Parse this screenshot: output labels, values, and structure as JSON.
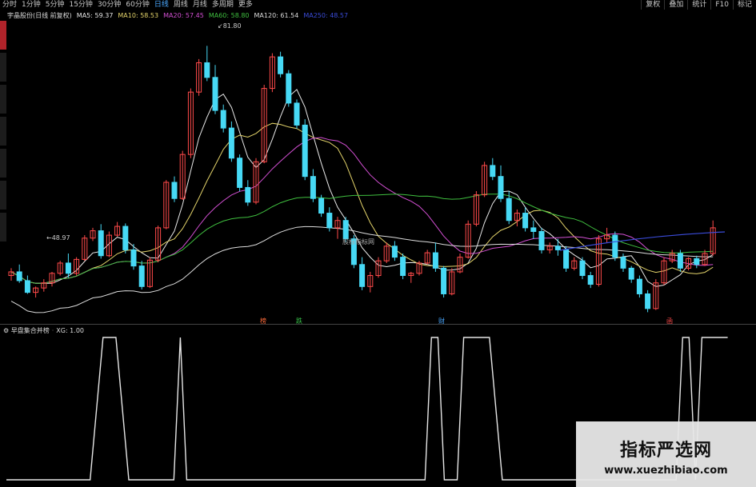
{
  "toolbar": {
    "periods": [
      "分时",
      "1分钟",
      "5分钟",
      "15分钟",
      "30分钟",
      "60分钟",
      "日线",
      "周线",
      "月线",
      "多周期",
      "更多"
    ],
    "active_period": "日线",
    "tools": [
      "复权",
      "叠加",
      "统计",
      "F10",
      "标记"
    ]
  },
  "legend": {
    "stock_title": "宇晶股份(日线 前复权)",
    "ma5": "MA5: 59.37",
    "ma10": "MA10: 58.53",
    "ma20": "MA20: 57.45",
    "ma60": "MA60: 58.80",
    "ma120": "MA120: 61.54",
    "ma250": "MA250: 48.57"
  },
  "colors": {
    "ma5": "#e8e8e8",
    "ma10": "#e3d36a",
    "ma20": "#d24fd2",
    "ma60": "#3fbf3f",
    "ma120": "#dcdcdc",
    "ma250": "#3a4bd8",
    "up": "#ff4a4a",
    "down": "#47d9f5",
    "active": "#4aa8ff"
  },
  "price_labels": {
    "high": "81.80",
    "low": "48.97"
  },
  "center_label": "股标指标网",
  "markers": [
    {
      "text": "榜",
      "color": "#ff6b3b"
    },
    {
      "text": "跌",
      "color": "#39c44a"
    },
    {
      "text": "财",
      "color": "#4aa8ff"
    },
    {
      "text": "函",
      "color": "#ff4a4a"
    }
  ],
  "indicator": {
    "name": "早盘集合并榜",
    "value": "XG: 1.00"
  },
  "watermark": {
    "title": "指标严选网",
    "url": "www.xuezhibiao.com"
  },
  "chart_data": {
    "type": "candlestick",
    "price_range": [
      45,
      85
    ],
    "candles": [
      [
        0,
        50.5,
        51.5,
        49.8,
        51
      ],
      [
        1,
        51,
        52,
        49.5,
        49.8
      ],
      [
        2,
        49.8,
        50.5,
        48,
        48.2
      ],
      [
        3,
        48.2,
        49,
        47.5,
        48.8
      ],
      [
        4,
        48.8,
        50,
        48.3,
        49.5
      ],
      [
        5,
        49.5,
        51,
        49,
        50.8
      ],
      [
        6,
        50.8,
        52.5,
        50.5,
        52.2
      ],
      [
        7,
        52.2,
        53.5,
        50.2,
        50.8
      ],
      [
        8,
        50.8,
        53,
        50.5,
        52.7
      ],
      [
        9,
        52.7,
        56,
        52.5,
        55.6
      ],
      [
        10,
        55.6,
        57,
        55.2,
        56.6
      ],
      [
        11,
        56.6,
        57.5,
        52.8,
        53.2
      ],
      [
        12,
        53.2,
        56.5,
        53,
        56
      ],
      [
        13,
        56,
        57.8,
        55.8,
        57.2
      ],
      [
        14,
        57.2,
        57.6,
        53.5,
        54
      ],
      [
        15,
        54,
        54.8,
        51.3,
        51.8
      ],
      [
        16,
        51.8,
        52.5,
        48.6,
        49
      ],
      [
        17,
        49,
        53,
        48.8,
        52.6
      ],
      [
        18,
        52.6,
        57.3,
        52.3,
        57
      ],
      [
        19,
        57,
        63.5,
        56.8,
        63.2
      ],
      [
        20,
        63.2,
        64,
        60.5,
        61
      ],
      [
        21,
        61,
        67.5,
        60.8,
        67
      ],
      [
        22,
        67,
        76,
        66.5,
        75.5
      ],
      [
        23,
        75.5,
        80,
        75,
        79.5
      ],
      [
        24,
        79.5,
        81.8,
        77,
        77.5
      ],
      [
        25,
        77.5,
        79.2,
        72.5,
        73
      ],
      [
        26,
        73,
        73.8,
        70,
        70.6
      ],
      [
        27,
        70.6,
        71.5,
        66,
        66.5
      ],
      [
        28,
        66.5,
        67,
        62,
        62.5
      ],
      [
        29,
        62.5,
        63.5,
        60,
        60.5
      ],
      [
        30,
        60.5,
        66.5,
        60.2,
        66
      ],
      [
        31,
        66,
        76.5,
        65.8,
        76
      ],
      [
        32,
        76,
        80.8,
        75.5,
        80.3
      ],
      [
        33,
        80.3,
        81,
        77.5,
        78
      ],
      [
        34,
        78,
        78.5,
        73.5,
        74
      ],
      [
        35,
        74,
        74.5,
        70.5,
        71
      ],
      [
        36,
        71,
        71.8,
        63.5,
        64
      ],
      [
        37,
        64,
        65,
        60.5,
        61
      ],
      [
        38,
        61,
        61.5,
        58.5,
        59
      ],
      [
        39,
        59,
        59.8,
        56.5,
        57
      ],
      [
        40,
        57,
        58.5,
        55.5,
        58
      ],
      [
        41,
        58,
        58.5,
        55,
        55.5
      ],
      [
        42,
        55.5,
        56,
        51.5,
        52
      ],
      [
        43,
        52,
        53,
        48.5,
        49
      ],
      [
        44,
        49,
        51,
        48.2,
        50.5
      ],
      [
        45,
        50.5,
        53,
        50.2,
        52.5
      ],
      [
        46,
        52.5,
        55,
        52.2,
        54.5
      ],
      [
        47,
        54.5,
        55.2,
        52.5,
        53
      ],
      [
        48,
        53,
        53.5,
        50,
        50.5
      ],
      [
        49,
        50.5,
        51,
        49.5,
        50.8
      ],
      [
        50,
        50.8,
        52.5,
        50.5,
        52.2
      ],
      [
        51,
        52.2,
        54,
        52,
        53.6
      ],
      [
        52,
        53.6,
        55,
        51,
        51.5
      ],
      [
        53,
        51.5,
        51.8,
        47.5,
        48
      ],
      [
        54,
        48,
        51.5,
        47.8,
        51
      ],
      [
        55,
        51,
        53.5,
        50.8,
        53
      ],
      [
        56,
        53,
        58,
        52.8,
        57.5
      ],
      [
        57,
        57.5,
        62,
        57.2,
        61.5
      ],
      [
        58,
        61.5,
        66,
        61.2,
        65.5
      ],
      [
        59,
        65.5,
        66.5,
        63.5,
        64
      ],
      [
        60,
        64,
        65.5,
        60.5,
        61
      ],
      [
        61,
        61,
        62,
        57.5,
        58
      ],
      [
        62,
        58,
        59.5,
        57.2,
        59
      ],
      [
        63,
        59,
        59.8,
        56.5,
        57
      ],
      [
        64,
        57,
        58,
        55.5,
        56.5
      ],
      [
        65,
        56.5,
        57,
        53.5,
        54
      ],
      [
        66,
        54,
        55,
        53.5,
        54.5
      ],
      [
        67,
        54.5,
        55.5,
        53.2,
        54
      ],
      [
        68,
        54,
        54.5,
        51,
        51.5
      ],
      [
        69,
        51.5,
        53,
        51.2,
        52.5
      ],
      [
        70,
        52.5,
        53,
        50,
        50.5
      ],
      [
        71,
        50.5,
        51,
        48.8,
        49.3
      ],
      [
        72,
        49.3,
        56,
        49,
        55.5
      ],
      [
        73,
        55.5,
        57,
        55,
        56
      ],
      [
        74,
        56,
        56.5,
        52.5,
        53
      ],
      [
        75,
        53,
        53.5,
        51,
        51.5
      ],
      [
        76,
        51.5,
        51.8,
        49.5,
        50
      ],
      [
        77,
        50,
        50.5,
        47.5,
        48
      ],
      [
        78,
        48,
        48.5,
        45.5,
        46
      ],
      [
        79,
        46,
        50,
        45.8,
        49.5
      ],
      [
        80,
        49.5,
        53,
        49.2,
        52.5
      ],
      [
        81,
        52.5,
        54,
        52.2,
        53.5
      ],
      [
        82,
        53.5,
        54,
        51,
        51.5
      ],
      [
        83,
        51.5,
        53,
        51.2,
        52.8
      ],
      [
        84,
        52.8,
        53.2,
        51.5,
        52
      ],
      [
        85,
        52,
        54,
        51.8,
        53.5
      ],
      [
        86,
        53.5,
        58,
        53.2,
        57
      ]
    ],
    "signal": [
      [
        0,
        0
      ],
      [
        13,
        0
      ],
      [
        15,
        1
      ],
      [
        17,
        1
      ],
      [
        19,
        0
      ],
      [
        26,
        0
      ],
      [
        27,
        1
      ],
      [
        28,
        0
      ],
      [
        65,
        0
      ],
      [
        66,
        1
      ],
      [
        67,
        1
      ],
      [
        68,
        0
      ],
      [
        70,
        0
      ],
      [
        71,
        1
      ],
      [
        75,
        1
      ],
      [
        77,
        0
      ],
      [
        104,
        0
      ],
      [
        105,
        1
      ],
      [
        106,
        1
      ],
      [
        107,
        0
      ],
      [
        108,
        1
      ],
      [
        112,
        1
      ]
    ]
  }
}
